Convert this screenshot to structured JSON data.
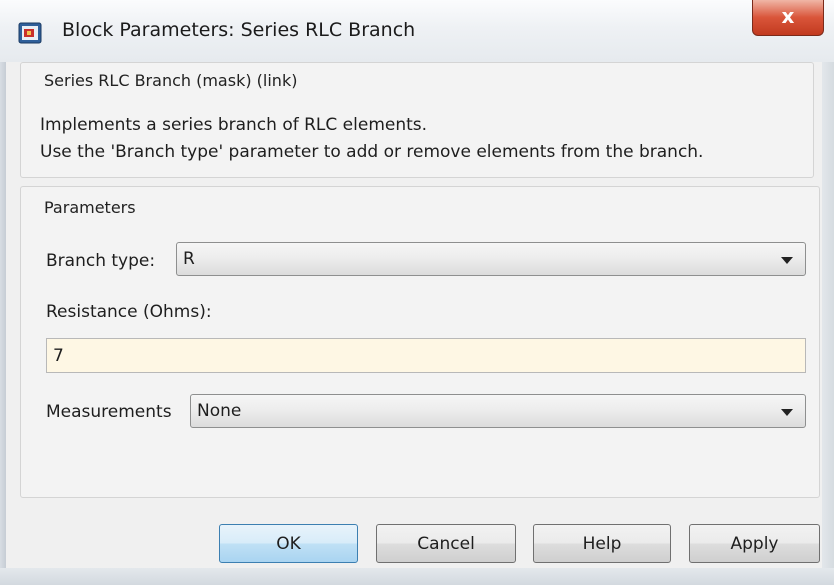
{
  "window": {
    "title": "Block Parameters: Series RLC Branch",
    "close_glyph": "x"
  },
  "description": {
    "legend": "Series RLC Branch (mask) (link)",
    "line1": "Implements a series branch of RLC elements.",
    "line2": "Use the 'Branch type' parameter to add or remove elements from the branch."
  },
  "parameters": {
    "legend": "Parameters",
    "branch_type": {
      "label": "Branch type:",
      "value": "R"
    },
    "resistance": {
      "label": "Resistance (Ohms):",
      "value": "7"
    },
    "measurements": {
      "label": "Measurements",
      "value": "None"
    }
  },
  "buttons": {
    "ok": "OK",
    "cancel": "Cancel",
    "help": "Help",
    "apply": "Apply"
  },
  "colors": {
    "input_background": "#fef7e4",
    "close_button": "#d9553a",
    "ok_button_border": "#3c7fb1"
  },
  "icons": {
    "app": "simulink-block-icon",
    "dropdown": "chevron-down-icon"
  }
}
